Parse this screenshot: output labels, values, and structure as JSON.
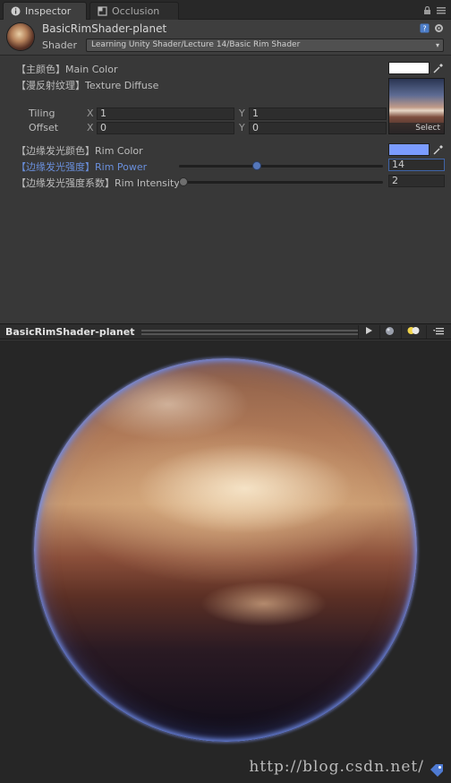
{
  "tabs": [
    {
      "label": "Inspector",
      "icon": "info-icon"
    },
    {
      "label": "Occlusion",
      "icon": "occlusion-icon"
    }
  ],
  "header": {
    "material_name": "BasicRimShader-planet",
    "shader_label": "Shader",
    "shader_value": "Learning Unity Shader/Lecture 14/Basic Rim Shader"
  },
  "properties": {
    "main_color": {
      "label": "【主颜色】Main Color",
      "color": "#ffffff"
    },
    "texture": {
      "label": "【漫反射纹理】Texture Diffuse",
      "select_label": "Select"
    },
    "tiling": {
      "label": "Tiling",
      "x_label": "X",
      "x": "1",
      "y_label": "Y",
      "y": "1"
    },
    "offset": {
      "label": "Offset",
      "x_label": "X",
      "x": "0",
      "y_label": "Y",
      "y": "0"
    },
    "rim_color": {
      "label": "【边缘发光颜色】Rim Color",
      "color": "#7b9cff"
    },
    "rim_power": {
      "label": "【边缘发光强度】Rim Power",
      "value": "14",
      "fraction": 0.38
    },
    "rim_intensity": {
      "label": "【边缘发光强度系数】Rim Intensity",
      "value": "2",
      "fraction": 0.0
    }
  },
  "preview": {
    "title": "BasicRimShader-planet",
    "watermark": "http://blog.csdn.net/"
  },
  "colors": {
    "accent": "#3f64a8",
    "highlight_label": "#6a8fdc",
    "rim": "#7b9cff"
  }
}
